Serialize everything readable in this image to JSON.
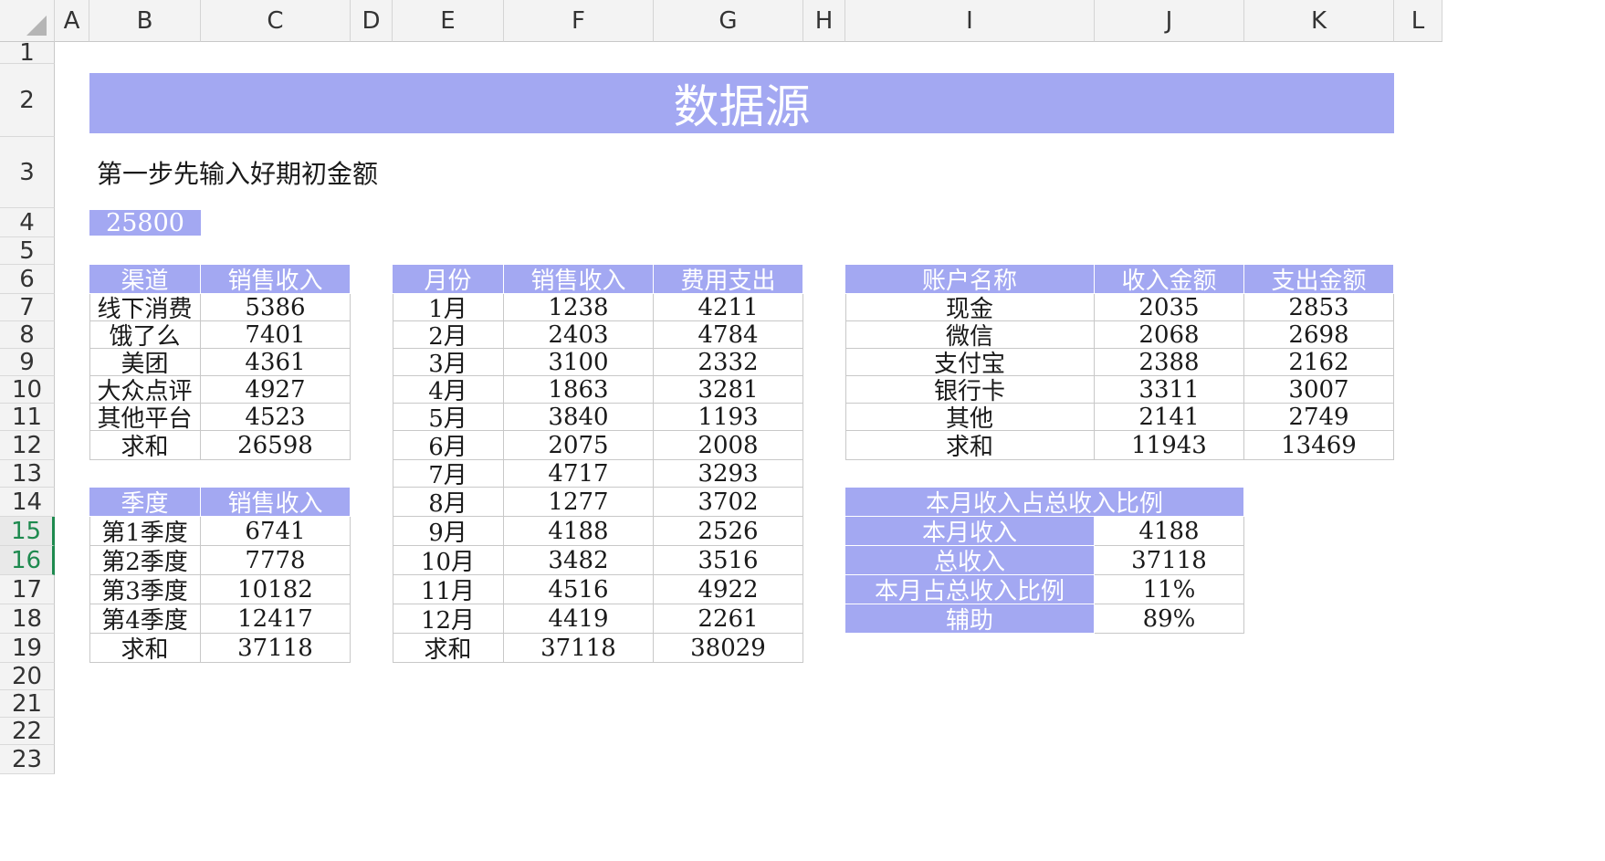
{
  "columns": [
    "A",
    "B",
    "C",
    "D",
    "E",
    "F",
    "G",
    "H",
    "I",
    "J",
    "K",
    "L"
  ],
  "rows": [
    "1",
    "2",
    "3",
    "4",
    "5",
    "6",
    "7",
    "8",
    "9",
    "10",
    "11",
    "12",
    "13",
    "14",
    "15",
    "16",
    "17",
    "18",
    "19",
    "20",
    "21",
    "22",
    "23"
  ],
  "selected_rows": [
    "15",
    "16"
  ],
  "colors": {
    "header_fill": "#a3a8f2",
    "header_text": "#ffffff",
    "selection": "#1e8a4f"
  },
  "banner": "数据源",
  "instruction": "第一步先输入好期初金额",
  "initial_amount": "25800",
  "channel_table": {
    "headers": [
      "渠道",
      "销售收入"
    ],
    "rows": [
      [
        "线下消费",
        "5386"
      ],
      [
        "饿了么",
        "7401"
      ],
      [
        "美团",
        "4361"
      ],
      [
        "大众点评",
        "4927"
      ],
      [
        "其他平台",
        "4523"
      ],
      [
        "求和",
        "26598"
      ]
    ]
  },
  "quarter_table": {
    "headers": [
      "季度",
      "销售收入"
    ],
    "rows": [
      [
        "第1季度",
        "6741"
      ],
      [
        "第2季度",
        "7778"
      ],
      [
        "第3季度",
        "10182"
      ],
      [
        "第4季度",
        "12417"
      ],
      [
        "求和",
        "37118"
      ]
    ]
  },
  "month_table": {
    "headers": [
      "月份",
      "销售收入",
      "费用支出"
    ],
    "rows": [
      [
        "1月",
        "1238",
        "4211"
      ],
      [
        "2月",
        "2403",
        "4784"
      ],
      [
        "3月",
        "3100",
        "2332"
      ],
      [
        "4月",
        "1863",
        "3281"
      ],
      [
        "5月",
        "3840",
        "1193"
      ],
      [
        "6月",
        "2075",
        "2008"
      ],
      [
        "7月",
        "4717",
        "3293"
      ],
      [
        "8月",
        "1277",
        "3702"
      ],
      [
        "9月",
        "4188",
        "2526"
      ],
      [
        "10月",
        "3482",
        "3516"
      ],
      [
        "11月",
        "4516",
        "4922"
      ],
      [
        "12月",
        "4419",
        "2261"
      ],
      [
        "求和",
        "37118",
        "38029"
      ]
    ]
  },
  "account_table": {
    "headers": [
      "账户名称",
      "收入金额",
      "支出金额"
    ],
    "rows": [
      [
        "现金",
        "2035",
        "2853"
      ],
      [
        "微信",
        "2068",
        "2698"
      ],
      [
        "支付宝",
        "2388",
        "2162"
      ],
      [
        "银行卡",
        "3311",
        "3007"
      ],
      [
        "其他",
        "2141",
        "2749"
      ],
      [
        "求和",
        "11943",
        "13469"
      ]
    ]
  },
  "ratio_table": {
    "title": "本月收入占总收入比例",
    "rows": [
      [
        "本月收入",
        "4188"
      ],
      [
        "总收入",
        "37118"
      ],
      [
        "本月占总收入比例",
        "11%"
      ],
      [
        "辅助",
        "89%"
      ]
    ]
  }
}
